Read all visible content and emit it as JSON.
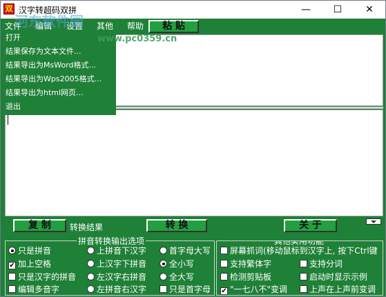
{
  "window": {
    "icon_glyph": "双",
    "title": "汉字转超码双拼",
    "controls": {
      "minimize": "—",
      "maximize": "☐",
      "close": "✕"
    }
  },
  "menubar": {
    "items": [
      "文件",
      "编辑",
      "设置",
      "其他",
      "帮助"
    ]
  },
  "toolbar": {
    "paste_label": "粘 贴"
  },
  "file_menu": {
    "items": [
      "打开",
      "结果保存为文本文件...",
      "结果导出为MsWord格式...",
      "结果导出为Wps2005格式...",
      "结果导出为html网页...",
      "退出"
    ]
  },
  "actions": {
    "copy_label": "复 制",
    "convert_result_label": "转换结果",
    "convert_label": "转 换",
    "close_label": "关 于"
  },
  "pinyin_options": {
    "title": "拼音转换输出选项",
    "options": [
      {
        "label": "只是拼音",
        "type": "radio",
        "checked": true
      },
      {
        "label": "上拼音下汉字",
        "type": "radio",
        "checked": false
      },
      {
        "label": "首字母大写",
        "type": "radio",
        "checked": false
      },
      {
        "label": "加上空格",
        "type": "checkbox",
        "checked": true
      },
      {
        "label": "上汉字下拼音",
        "type": "radio",
        "checked": false
      },
      {
        "label": "全小写",
        "type": "radio",
        "checked": true
      },
      {
        "label": "只是汉字的拼音",
        "type": "checkbox",
        "checked": false
      },
      {
        "label": "左汉字右拼音",
        "type": "radio",
        "checked": false
      },
      {
        "label": "全大写",
        "type": "radio",
        "checked": false
      },
      {
        "label": "编辑多音字",
        "type": "checkbox",
        "checked": false
      },
      {
        "label": "左拼音右汉字",
        "type": "radio",
        "checked": false
      },
      {
        "label": "只是首字母",
        "type": "checkbox",
        "checked": false
      }
    ]
  },
  "other_functions": {
    "title": "其他实用功能",
    "options": [
      {
        "label": "屏幕抓词(移动鼠标到汉字上, 按下Ctrl键",
        "checked": false
      },
      {
        "label": "支持繁体字",
        "checked": false
      },
      {
        "label": "支持分词",
        "checked": false
      },
      {
        "label": "检测剪贴板",
        "checked": false
      },
      {
        "label": "启动时显示示例",
        "checked": false
      },
      {
        "label": "\"一七八不\"变调",
        "checked": true
      },
      {
        "label": "上声在上声前变调",
        "checked": false
      }
    ]
  },
  "watermark": {
    "text": "河东软件园",
    "url": "www.pc0359.cn"
  },
  "colors": {
    "window_bg": "#1f8037",
    "button_bg": "#22a041"
  }
}
